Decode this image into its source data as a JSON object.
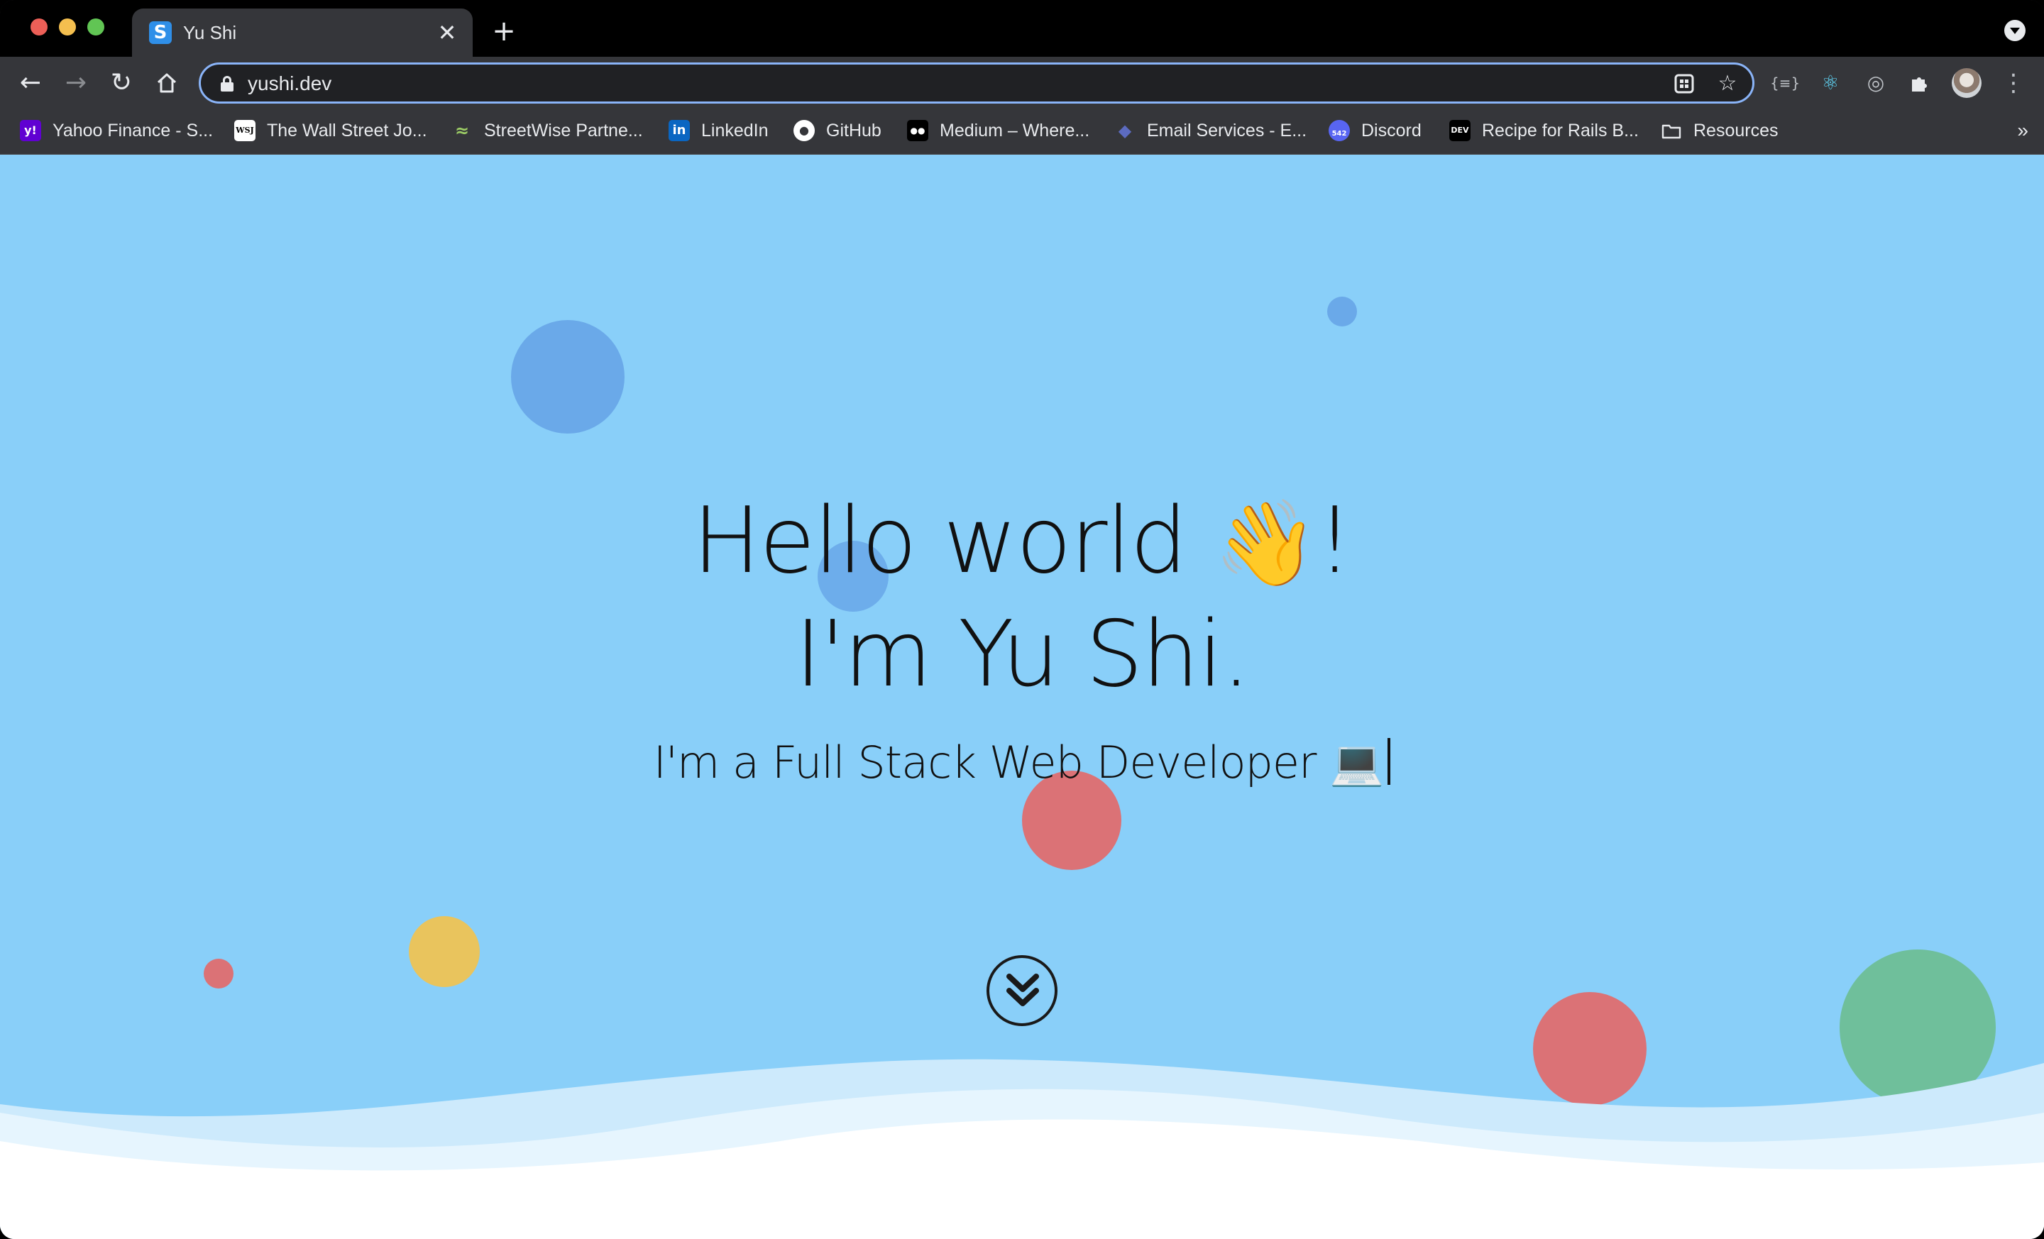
{
  "browser": {
    "tab": {
      "title": "Yu Shi",
      "favicon_letter": "S",
      "close_glyph": "✕"
    },
    "new_tab_glyph": "+",
    "address": {
      "url": "yushi.dev"
    },
    "bookmarks": [
      {
        "label": "Yahoo Finance - S...",
        "icon_text": "y!",
        "icon_color": "#6001d2"
      },
      {
        "label": "The Wall Street Jo...",
        "icon_text": "WSJ",
        "icon_color": "#ffffff"
      },
      {
        "label": "StreetWise Partne...",
        "icon_text": "≈",
        "icon_color": "#35363a"
      },
      {
        "label": "LinkedIn",
        "icon_text": "in",
        "icon_color": "#0a66c2"
      },
      {
        "label": "GitHub",
        "icon_text": "●",
        "icon_color": "#35363a"
      },
      {
        "label": "Medium – Where...",
        "icon_text": "●●",
        "icon_color": "#000000"
      },
      {
        "label": "Email Services - E...",
        "icon_text": "◆",
        "icon_color": "#35363a"
      },
      {
        "label": "Discord",
        "icon_text": "542",
        "icon_color": "#5865f2"
      },
      {
        "label": "Recipe for Rails B...",
        "icon_text": "DEV",
        "icon_color": "#000000"
      },
      {
        "label": "Resources",
        "icon_text": "",
        "icon_color": "#35363a"
      }
    ],
    "bookmarks_overflow": "»"
  },
  "page": {
    "background": "#89cff9",
    "greeting": "Hello world",
    "greeting_emoji": "👋",
    "greeting_end": "!",
    "name_line": "I'm Yu Shi.",
    "tagline": "I'm a Full Stack Web Developer 💻",
    "accent_colors": {
      "blue": "#6aa9e9",
      "red": "#db7276",
      "yellow": "#e9c45d",
      "green": "#6fbf9b"
    }
  }
}
